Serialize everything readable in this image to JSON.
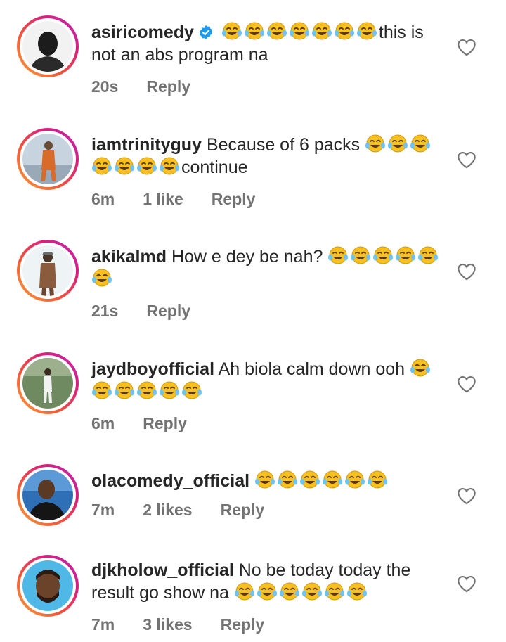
{
  "comments": [
    {
      "username": "asiricomedy",
      "verified": true,
      "text_before": "",
      "emoji_before": 7,
      "text_after": "this is not an abs program na",
      "emoji_after": 0,
      "time": "20s",
      "likes": "",
      "reply": "Reply"
    },
    {
      "username": "iamtrinityguy",
      "verified": false,
      "text_before": "Because of 6 packs",
      "emoji_before": 7,
      "text_after": "continue",
      "emoji_after": 0,
      "time": "6m",
      "likes": "1 like",
      "reply": "Reply"
    },
    {
      "username": "akikalmd",
      "verified": false,
      "text_before": "How e dey be nah?",
      "emoji_before": 6,
      "text_after": "",
      "emoji_after": 0,
      "time": "21s",
      "likes": "",
      "reply": "Reply"
    },
    {
      "username": "jaydboyofficial",
      "verified": false,
      "text_before": "Ah biola calm down ooh",
      "emoji_before": 0,
      "text_after": "",
      "emoji_after": 6,
      "time": "6m",
      "likes": "",
      "reply": "Reply"
    },
    {
      "username": "olacomedy_official",
      "verified": false,
      "text_before": "",
      "emoji_before": 6,
      "text_after": "",
      "emoji_after": 0,
      "time": "7m",
      "likes": "2 likes",
      "reply": "Reply"
    },
    {
      "username": "djkholow_official",
      "verified": false,
      "text_before": "No be today today the result go show na",
      "emoji_before": 6,
      "text_after": "",
      "emoji_after": 0,
      "time": "7m",
      "likes": "3 likes",
      "reply": "Reply"
    }
  ],
  "icons": {
    "emoji": "face-with-tears-of-joy-icon",
    "like": "heart-outline-icon",
    "verified": "verified-badge-icon"
  },
  "colors": {
    "text": "#262626",
    "meta": "#737373",
    "verified": "#1d9bf0",
    "emoji": "#f6c021"
  }
}
